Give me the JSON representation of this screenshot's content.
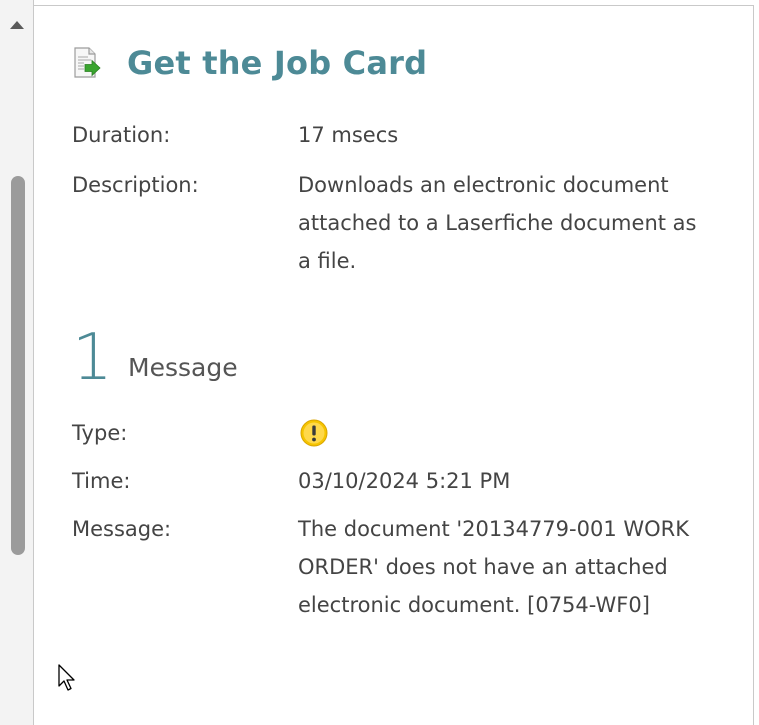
{
  "header": {
    "title": "Get the Job Card"
  },
  "details": {
    "duration_label": "Duration:",
    "duration_value": "17 msecs",
    "description_label": "Description:",
    "description_value": "Downloads an electronic document attached to a Laserfiche document as a file."
  },
  "messages_section": {
    "count": "1",
    "title": "Message"
  },
  "message": {
    "type_label": "Type:",
    "type_icon": "warning-icon",
    "time_label": "Time:",
    "time_value": "03/10/2024 5:21 PM",
    "message_label": "Message:",
    "message_value": "The document '20134779-001 WORK ORDER' does not have an attached electronic document. [0754-WF0]"
  },
  "colors": {
    "accent": "#4d8a96",
    "text": "#444444",
    "warning": "#f2c200"
  }
}
